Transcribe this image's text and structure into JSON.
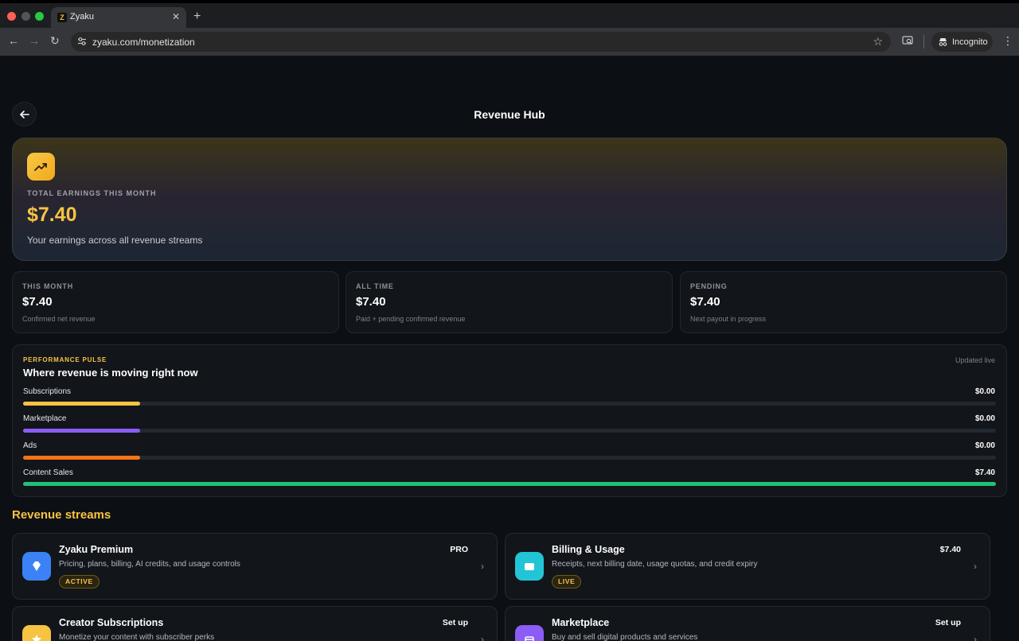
{
  "browser": {
    "tab_title": "Zyaku",
    "tab_favicon": "Z",
    "url": "zyaku.com/monetization",
    "incognito_label": "Incognito"
  },
  "page": {
    "title": "Revenue Hub"
  },
  "hero": {
    "label": "TOTAL EARNINGS THIS MONTH",
    "amount": "$7.40",
    "subtitle": "Your earnings across all revenue streams",
    "icon": "trending-up-icon"
  },
  "stats": [
    {
      "label": "THIS MONTH",
      "value": "$7.40",
      "sub": "Confirmed net revenue"
    },
    {
      "label": "ALL TIME",
      "value": "$7.40",
      "sub": "Paid + pending confirmed revenue"
    },
    {
      "label": "PENDING",
      "value": "$7.40",
      "sub": "Next payout in progress"
    }
  ],
  "pulse": {
    "kicker": "PERFORMANCE PULSE",
    "title": "Where revenue is moving right now",
    "updated": "Updated live",
    "rows": [
      {
        "name": "Subscriptions",
        "value": "$0.00",
        "fill": 0.12,
        "color": "#f6c343"
      },
      {
        "name": "Marketplace",
        "value": "$0.00",
        "fill": 0.12,
        "color": "#8b5cf6"
      },
      {
        "name": "Ads",
        "value": "$0.00",
        "fill": 0.12,
        "color": "#f97316"
      },
      {
        "name": "Content Sales",
        "value": "$7.40",
        "fill": 1.0,
        "color": "#22c07a"
      }
    ]
  },
  "streams": {
    "title": "Revenue streams",
    "cards": [
      {
        "title": "Zyaku Premium",
        "desc": "Pricing, plans, billing, AI credits, and usage controls",
        "tag": "PRO",
        "badge": "ACTIVE",
        "icon": "diamond-icon",
        "color": "#3b82f6"
      },
      {
        "title": "Billing & Usage",
        "desc": "Receipts, next billing date, usage quotas, and credit expiry",
        "tag": "$7.40",
        "badge": "LIVE",
        "icon": "wallet-icon",
        "color": "#22c5d6"
      },
      {
        "title": "Creator Subscriptions",
        "desc": "Monetize your content with subscriber perks",
        "tag": "Set up",
        "badge": "",
        "icon": "star-icon",
        "color": "#f6c343"
      },
      {
        "title": "Marketplace",
        "desc": "Buy and sell digital products and services",
        "tag": "Set up",
        "badge": "",
        "icon": "store-icon",
        "color": "#8b5cf6"
      }
    ]
  }
}
